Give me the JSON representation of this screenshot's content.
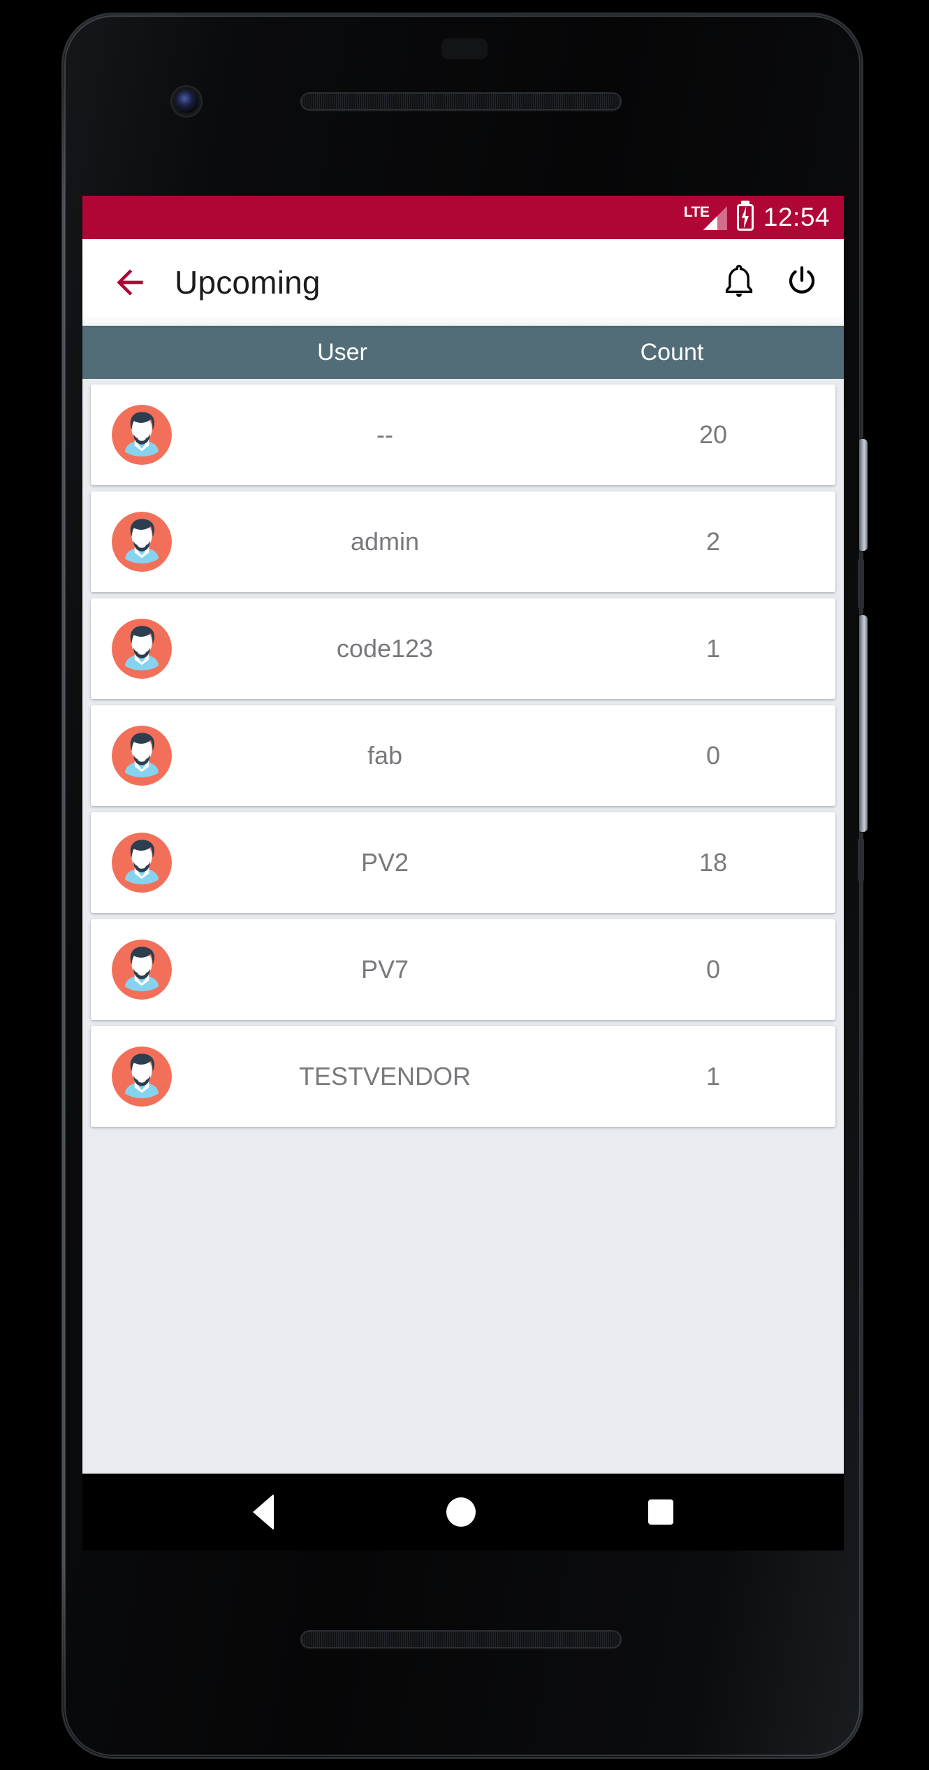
{
  "colors": {
    "status_bar": "#b00635",
    "accent_crimson": "#b00635",
    "table_header": "#536d78",
    "page_background": "#e8ebef",
    "row_background": "#ffffff",
    "row_text": "#77797c",
    "avatar_circle": "#f2705a",
    "avatar_hair": "#2c3e50",
    "avatar_shirt": "#85d3ef",
    "navbar": "#000000"
  },
  "status_bar": {
    "network_label": "LTE",
    "signal_icon": "signal-bars-icon",
    "battery_icon": "battery-charging-icon",
    "time": "12:54"
  },
  "app_bar": {
    "back_icon": "back-arrow-icon",
    "title": "Upcoming",
    "notification_icon": "bell-icon",
    "power_icon": "power-icon"
  },
  "table": {
    "columns": [
      {
        "key": "user",
        "label": "User"
      },
      {
        "key": "count",
        "label": "Count"
      }
    ],
    "rows": [
      {
        "avatar": "user-avatar-icon",
        "user": "--",
        "count": "20"
      },
      {
        "avatar": "user-avatar-icon",
        "user": "admin",
        "count": "2"
      },
      {
        "avatar": "user-avatar-icon",
        "user": "code123",
        "count": "1"
      },
      {
        "avatar": "user-avatar-icon",
        "user": "fab",
        "count": "0"
      },
      {
        "avatar": "user-avatar-icon",
        "user": "PV2",
        "count": "18"
      },
      {
        "avatar": "user-avatar-icon",
        "user": "PV7",
        "count": "0"
      },
      {
        "avatar": "user-avatar-icon",
        "user": "TESTVENDOR",
        "count": "1"
      }
    ]
  },
  "nav_bar": {
    "back_label": "back-triangle-icon",
    "home_label": "home-circle-icon",
    "recents_label": "recents-square-icon"
  }
}
